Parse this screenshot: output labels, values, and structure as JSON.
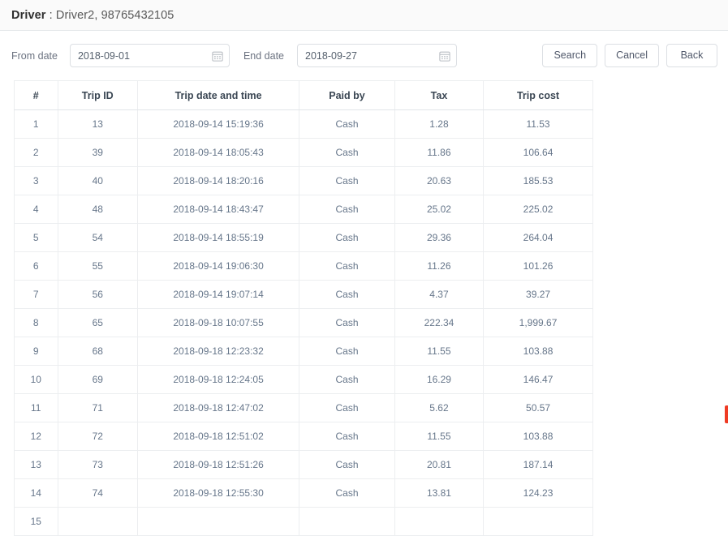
{
  "header": {
    "title_label": "Driver",
    "title_separator": " : ",
    "title_value": "Driver2, 98765432105"
  },
  "filter_bar": {
    "from_label": "From date",
    "from_value": "2018-09-01",
    "from_placeholder": "From date",
    "end_label": "End date",
    "end_value": "2018-09-27",
    "end_placeholder": "End date",
    "calendar_icon": "calendar-icon",
    "search_label": "Search",
    "cancel_label": "Cancel",
    "back_label": "Back"
  },
  "table": {
    "columns": [
      "#",
      "Trip ID",
      "Trip date and time",
      "Paid by",
      "Tax",
      "Trip cost"
    ],
    "rows": [
      [
        "1",
        "13",
        "2018-09-14 15:19:36",
        "Cash",
        "1.28",
        "11.53"
      ],
      [
        "2",
        "39",
        "2018-09-14 18:05:43",
        "Cash",
        "11.86",
        "106.64"
      ],
      [
        "3",
        "40",
        "2018-09-14 18:20:16",
        "Cash",
        "20.63",
        "185.53"
      ],
      [
        "4",
        "48",
        "2018-09-14 18:43:47",
        "Cash",
        "25.02",
        "225.02"
      ],
      [
        "5",
        "54",
        "2018-09-14 18:55:19",
        "Cash",
        "29.36",
        "264.04"
      ],
      [
        "6",
        "55",
        "2018-09-14 19:06:30",
        "Cash",
        "11.26",
        "101.26"
      ],
      [
        "7",
        "56",
        "2018-09-14 19:07:14",
        "Cash",
        "4.37",
        "39.27"
      ],
      [
        "8",
        "65",
        "2018-09-18 10:07:55",
        "Cash",
        "222.34",
        "1,999.67"
      ],
      [
        "9",
        "68",
        "2018-09-18 12:23:32",
        "Cash",
        "11.55",
        "103.88"
      ],
      [
        "10",
        "69",
        "2018-09-18 12:24:05",
        "Cash",
        "16.29",
        "146.47"
      ],
      [
        "11",
        "71",
        "2018-09-18 12:47:02",
        "Cash",
        "5.62",
        "50.57"
      ],
      [
        "12",
        "72",
        "2018-09-18 12:51:02",
        "Cash",
        "11.55",
        "103.88"
      ],
      [
        "13",
        "73",
        "2018-09-18 12:51:26",
        "Cash",
        "20.81",
        "187.14"
      ],
      [
        "14",
        "74",
        "2018-09-18 12:55:30",
        "Cash",
        "13.81",
        "124.23"
      ],
      [
        "15",
        "",
        "",
        "",
        "",
        ""
      ]
    ]
  },
  "colors": {
    "accent_red": "#ef3b24",
    "header_bg": "#fafafa",
    "border": "#eceef0"
  }
}
